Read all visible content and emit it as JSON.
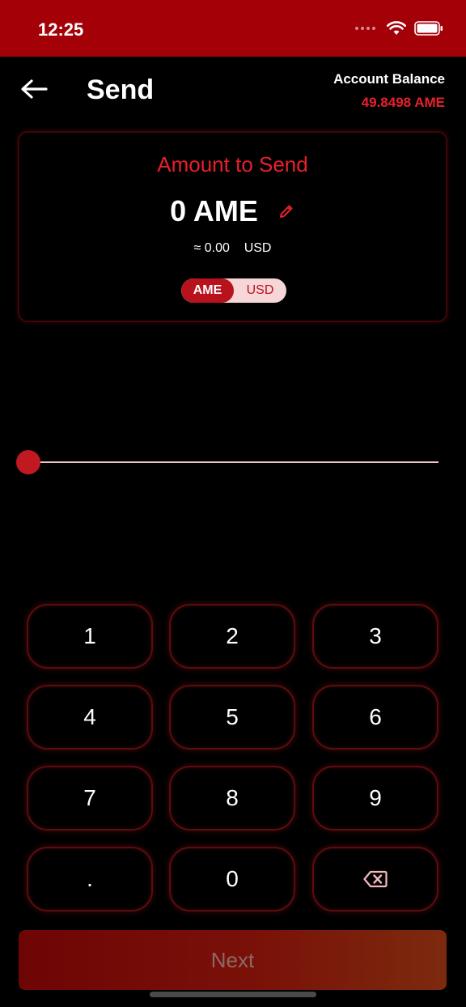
{
  "status_bar": {
    "time": "12:25"
  },
  "header": {
    "title": "Send",
    "balance_label": "Account Balance",
    "balance_value": "49.8498 AME"
  },
  "amount_card": {
    "heading": "Amount to Send",
    "amount": "0 AME",
    "fiat_approx": "≈ 0.00",
    "fiat_currency": "USD",
    "toggle": {
      "options": [
        "AME",
        "USD"
      ],
      "selected": "AME"
    }
  },
  "slider": {
    "value_fraction": 0
  },
  "keypad": {
    "keys": [
      "1",
      "2",
      "3",
      "4",
      "5",
      "6",
      "7",
      "8",
      "9",
      ".",
      "0"
    ]
  },
  "footer": {
    "next_label": "Next"
  },
  "colors": {
    "status_bar": "#a30008",
    "accent_red": "#e8202c",
    "toggle_active": "#b8131d",
    "key_border": "#5a0d10"
  }
}
